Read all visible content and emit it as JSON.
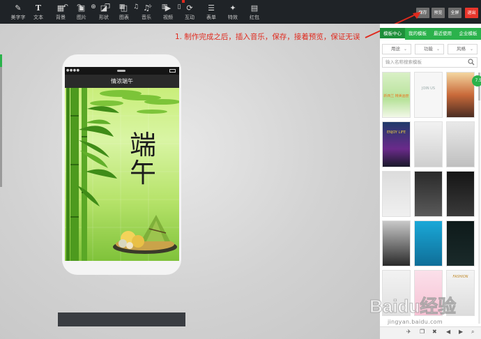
{
  "toolbar": {
    "items": [
      {
        "label": "美字字",
        "icon": "pen-icon"
      },
      {
        "label": "文本",
        "icon": "text-icon"
      },
      {
        "label": "背景",
        "icon": "grid-icon"
      },
      {
        "label": "图片",
        "icon": "image-icon"
      },
      {
        "label": "形状",
        "icon": "shape-icon"
      },
      {
        "label": "图表",
        "icon": "chart-icon"
      },
      {
        "label": "音乐",
        "icon": "music-icon"
      },
      {
        "label": "视频",
        "icon": "video-icon"
      },
      {
        "label": "互动",
        "icon": "interact-icon"
      },
      {
        "label": "表单",
        "icon": "form-icon"
      },
      {
        "label": "特效",
        "icon": "effect-icon"
      },
      {
        "label": "红包",
        "icon": "redpacket-icon"
      }
    ],
    "save": "保存",
    "preview": "预览",
    "fullscreen": "全屏",
    "exit": "退出"
  },
  "annotation": {
    "text": "1. 制作完成之后，插入音乐，保存，接着预览，保证无误",
    "color": "#e02a1e"
  },
  "phone": {
    "status_dots": "●●●●",
    "title": "情浓端午",
    "calligraphy_line1": "端",
    "calligraphy_line2": "午"
  },
  "bottom_toolbar": {
    "icons": [
      "undo-icon",
      "redo-icon",
      "add-icon",
      "copy-icon",
      "grid-icon",
      "music-icon",
      "magic-icon",
      "layout-icon",
      "phone-icon"
    ]
  },
  "panel": {
    "tabs": [
      "模板中心",
      "我的模板",
      "最近使用",
      "企业模板"
    ],
    "active_tab": 0,
    "filters": [
      "用途",
      "功能",
      "风格"
    ],
    "search_placeholder": "输入名称搜索模板",
    "badge": "7.5",
    "templates": [
      {
        "caption": "新西兰 精美画册"
      },
      {
        "caption": "JOIN US"
      },
      {
        "caption": ""
      },
      {
        "caption": "ENJOY LIFE"
      },
      {
        "caption": ""
      },
      {
        "caption": ""
      },
      {
        "caption": ""
      },
      {
        "caption": ""
      },
      {
        "caption": ""
      },
      {
        "caption": ""
      },
      {
        "caption": ""
      },
      {
        "caption": ""
      },
      {
        "caption": ""
      },
      {
        "caption": ""
      },
      {
        "caption": "FASHION"
      }
    ]
  },
  "watermark": {
    "logo": "Baidu经验",
    "url": "jingyan.baidu.com"
  },
  "accent": "#2bb24c",
  "danger": "#e02a1e"
}
